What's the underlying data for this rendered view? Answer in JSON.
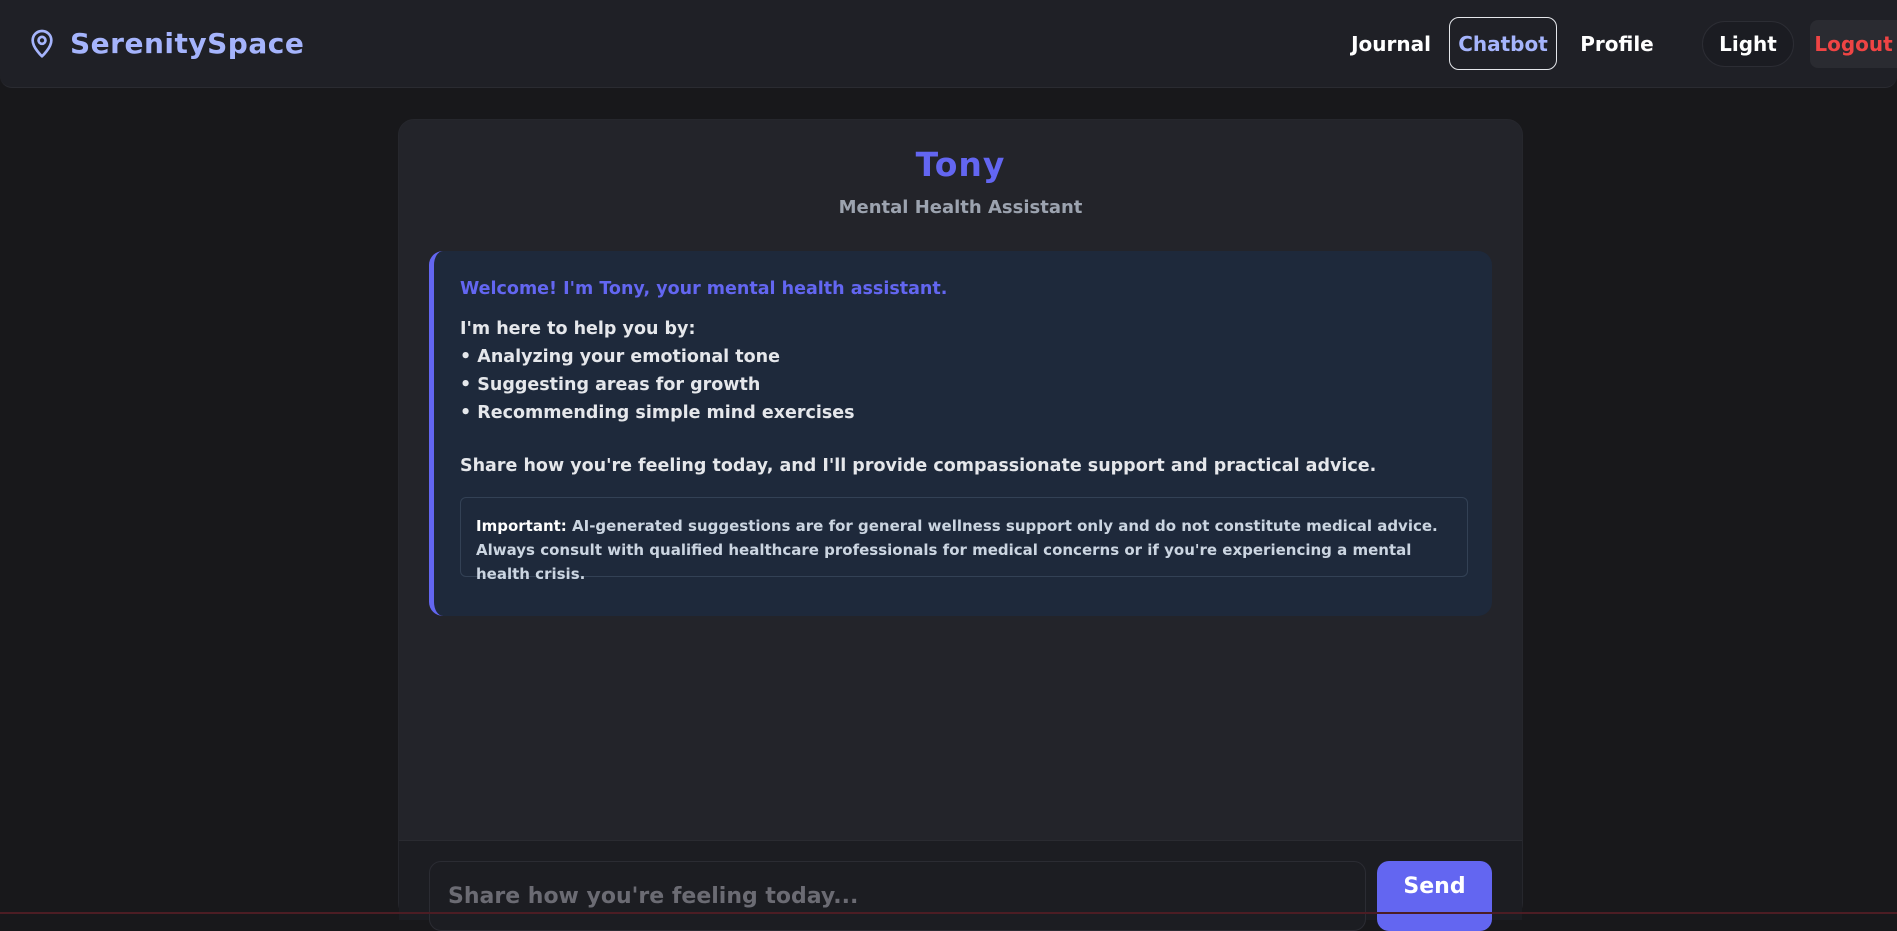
{
  "brand": {
    "name": "SerenitySpace",
    "icon": "location-pin-icon"
  },
  "nav": {
    "journal": "Journal",
    "chatbot": "Chatbot",
    "profile": "Profile",
    "theme": "Light",
    "logout": "Logout",
    "active": "Chatbot"
  },
  "chat": {
    "bot_name": "Tony",
    "bot_role": "Mental Health Assistant",
    "message": {
      "welcome": "Welcome! I'm Tony, your mental health assistant.",
      "intro": "I'm here to help you by:",
      "bullets": [
        "• Analyzing your emotional tone",
        "• Suggesting areas for growth",
        "• Recommending simple mind exercises"
      ],
      "share": "Share how you're feeling today, and I'll provide compassionate support and practical advice.",
      "disclaimer_label": "Important:",
      "disclaimer_text": " AI-generated suggestions are for general wellness support only and do not constitute medical advice. Always consult with qualified healthcare professionals for medical concerns or if you're experiencing a mental health crisis."
    },
    "input": {
      "placeholder": "Share how you're feeling today...",
      "value": ""
    },
    "send_label": "Send"
  },
  "colors": {
    "accent": "#6366f1",
    "brand": "#a5b4fc",
    "logout": "#ef4444",
    "background": "#18181b",
    "card": "#23242a",
    "message_bg": "#1e293b"
  }
}
